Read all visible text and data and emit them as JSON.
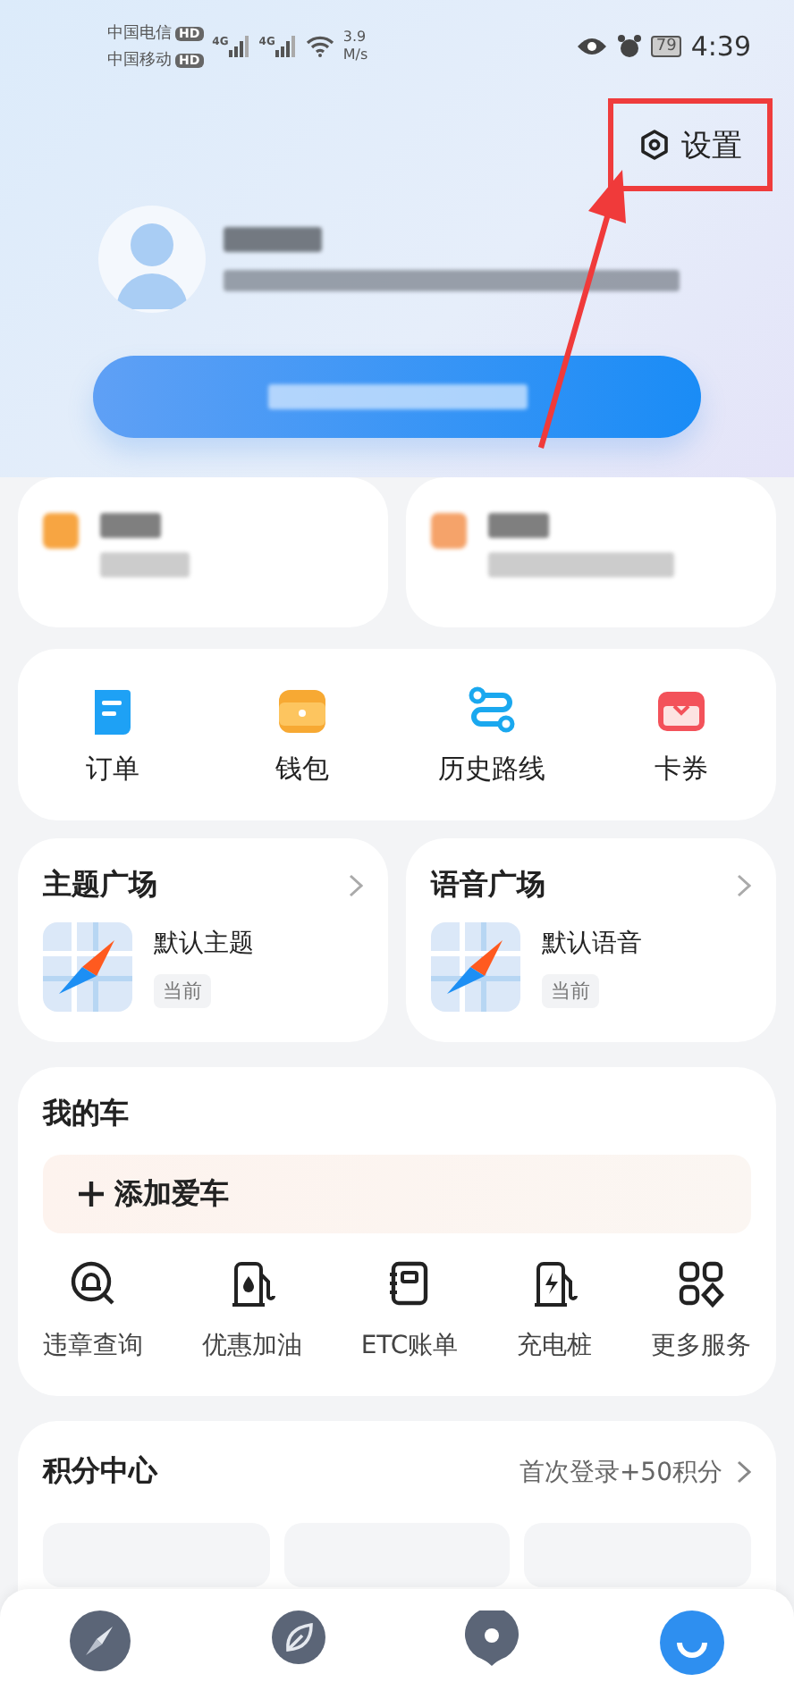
{
  "status_bar": {
    "carriers": [
      {
        "name": "中国电信",
        "badge": "HD"
      },
      {
        "name": "中国移动",
        "badge": "HD"
      }
    ],
    "signals": [
      "4G",
      "4G"
    ],
    "speed": "3.9",
    "speed_unit": "M/s",
    "battery": "79",
    "time": "4:39"
  },
  "settings_button": {
    "label": "设置",
    "highlighted": true
  },
  "shortcuts": [
    {
      "label": "订单"
    },
    {
      "label": "钱包"
    },
    {
      "label": "历史路线"
    },
    {
      "label": "卡券"
    }
  ],
  "squares": [
    {
      "title": "主题广场",
      "item": "默认主题",
      "tag": "当前"
    },
    {
      "title": "语音广场",
      "item": "默认语音",
      "tag": "当前"
    }
  ],
  "my_car": {
    "title": "我的车",
    "add_label": "添加爱车",
    "services": [
      {
        "label": "违章查询"
      },
      {
        "label": "优惠加油"
      },
      {
        "label": "ETC账单"
      },
      {
        "label": "充电桩"
      },
      {
        "label": "更多服务"
      }
    ]
  },
  "points": {
    "title": "积分中心",
    "promo": "首次登录+50积分"
  }
}
